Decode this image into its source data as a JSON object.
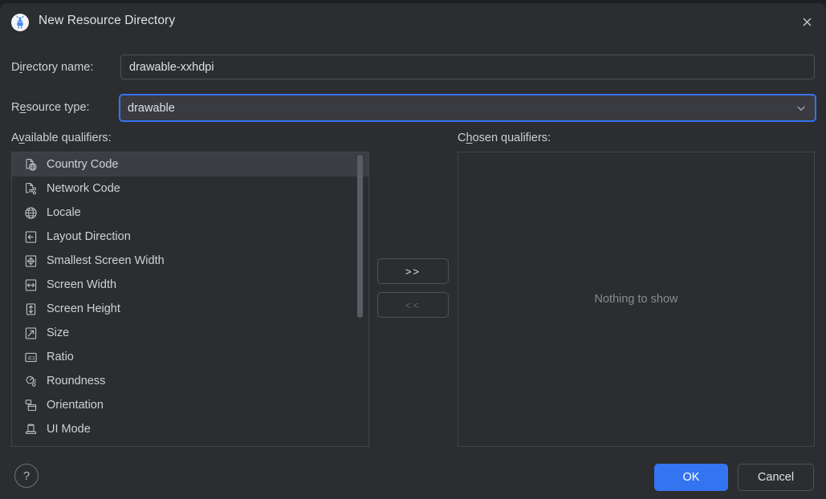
{
  "dialog": {
    "title": "New Resource Directory",
    "app_icon": "android-studio-icon",
    "close_icon": "close-icon",
    "accent_color": "#3574f0",
    "background_color": "#2b2d30"
  },
  "form": {
    "directory_name": {
      "label_before": "D",
      "label_mnemonic": "i",
      "label_after": "rectory name:",
      "label_full": "Directory name:",
      "value": "drawable-xxhdpi",
      "placeholder": ""
    },
    "resource_type": {
      "label_before": "R",
      "label_mnemonic": "e",
      "label_after": "source type:",
      "label_full": "Resource type:",
      "value": "drawable",
      "chevron_icon": "chevron-down-icon",
      "focused": true
    }
  },
  "available": {
    "label_before": "A",
    "label_mnemonic": "v",
    "label_after": "ailable qualifiers:",
    "label_full": "Available qualifiers:",
    "selected_index": 0,
    "items": [
      {
        "label": "Country Code",
        "icon": "country-code-icon"
      },
      {
        "label": "Network Code",
        "icon": "network-code-icon"
      },
      {
        "label": "Locale",
        "icon": "globe-icon"
      },
      {
        "label": "Layout Direction",
        "icon": "layout-direction-icon"
      },
      {
        "label": "Smallest Screen Width",
        "icon": "smallest-screen-width-icon"
      },
      {
        "label": "Screen Width",
        "icon": "screen-width-icon"
      },
      {
        "label": "Screen Height",
        "icon": "screen-height-icon"
      },
      {
        "label": "Size",
        "icon": "size-icon"
      },
      {
        "label": "Ratio",
        "icon": "ratio-icon"
      },
      {
        "label": "Roundness",
        "icon": "roundness-icon"
      },
      {
        "label": "Orientation",
        "icon": "orientation-icon"
      },
      {
        "label": "UI Mode",
        "icon": "ui-mode-icon"
      }
    ]
  },
  "transfer": {
    "add_label": ">>",
    "remove_label": "<<",
    "add_enabled": true,
    "remove_enabled": false
  },
  "chosen": {
    "label_before": "C",
    "label_mnemonic": "h",
    "label_after": "osen qualifiers:",
    "label_full": "Chosen qualifiers:",
    "empty_text": "Nothing to show",
    "items": []
  },
  "footer": {
    "help_label": "?",
    "ok_label": "OK",
    "cancel_label": "Cancel"
  }
}
